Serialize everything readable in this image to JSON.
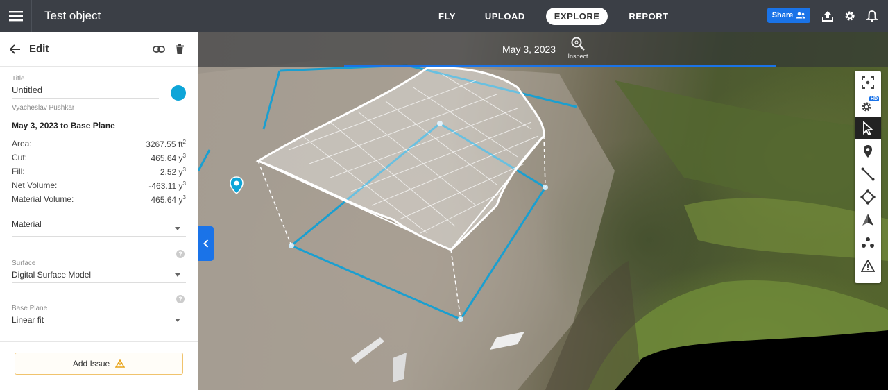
{
  "header": {
    "title": "Test object",
    "nav": [
      "FLY",
      "UPLOAD",
      "EXPLORE",
      "REPORT"
    ],
    "active_nav": "EXPLORE",
    "share_label": "Share"
  },
  "panel": {
    "header_title": "Edit",
    "title_label": "Title",
    "title_value": "Untitled",
    "author": "Vyacheslav Pushkar",
    "section_title": "May 3, 2023 to Base Plane",
    "stats": [
      {
        "label": "Area:",
        "value": "3267.55 ft",
        "unit_sup": "2"
      },
      {
        "label": "Cut:",
        "value": "465.64 y",
        "unit_sup": "3"
      },
      {
        "label": "Fill:",
        "value": "2.52 y",
        "unit_sup": "3"
      },
      {
        "label": "Net Volume:",
        "value": "-463.11 y",
        "unit_sup": "3"
      },
      {
        "label": "Material Volume:",
        "value": "465.64 y",
        "unit_sup": "3"
      }
    ],
    "material_label": "Material",
    "surface_label": "Surface",
    "surface_value": "Digital Surface Model",
    "base_plane_label": "Base Plane",
    "base_plane_value": "Linear fit",
    "help_mark": "?",
    "add_issue_label": "Add Issue",
    "accent_color": "#0ea5d8"
  },
  "viewport": {
    "date": "May 3, 2023",
    "inspect_label": "Inspect",
    "hd_badge": "HD"
  },
  "toolbar": {
    "tools": [
      "focus-tool",
      "hd-settings-tool",
      "select-tool",
      "pin-tool",
      "line-tool",
      "area-tool",
      "volume-tool",
      "points-tool",
      "issue-tool"
    ],
    "active_tool": "select-tool"
  }
}
